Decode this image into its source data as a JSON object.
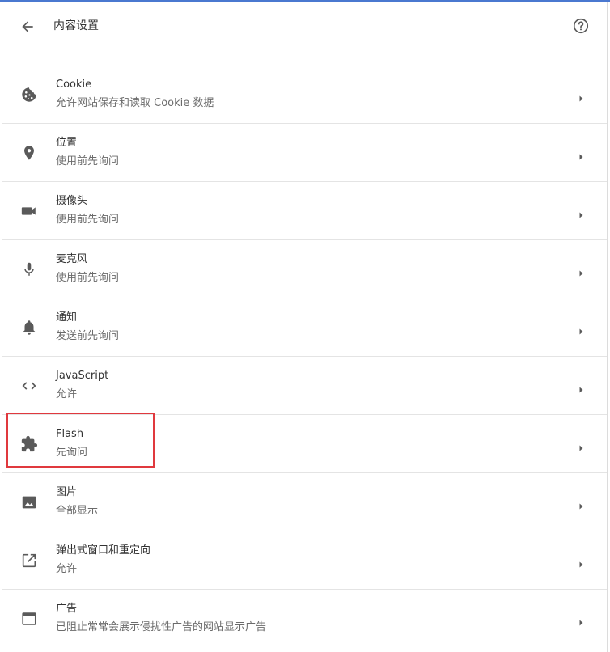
{
  "header": {
    "title": "内容设置",
    "back_icon": "arrow-left-icon",
    "help_icon": "help-circle-icon"
  },
  "settings": [
    {
      "label": "Cookie",
      "sub": "允许网站保存和读取 Cookie 数据",
      "icon": "cookie-icon"
    },
    {
      "label": "位置",
      "sub": "使用前先询问",
      "icon": "location-pin-icon"
    },
    {
      "label": "摄像头",
      "sub": "使用前先询问",
      "icon": "camera-icon"
    },
    {
      "label": "麦克风",
      "sub": "使用前先询问",
      "icon": "microphone-icon"
    },
    {
      "label": "通知",
      "sub": "发送前先询问",
      "icon": "bell-icon"
    },
    {
      "label": "JavaScript",
      "sub": "允许",
      "icon": "code-icon"
    },
    {
      "label": "Flash",
      "sub": "先询问",
      "icon": "puzzle-piece-icon"
    },
    {
      "label": "图片",
      "sub": "全部显示",
      "icon": "image-icon"
    },
    {
      "label": "弹出式窗口和重定向",
      "sub": "允许",
      "icon": "open-in-new-icon"
    },
    {
      "label": "广告",
      "sub": "已阻止常常会展示侵扰性广告的网站显示广告",
      "icon": "ad-window-icon"
    }
  ],
  "colors": {
    "top_accent": "#4a78d0",
    "icon": "#5a5a5a",
    "highlight": "#e0393e"
  }
}
